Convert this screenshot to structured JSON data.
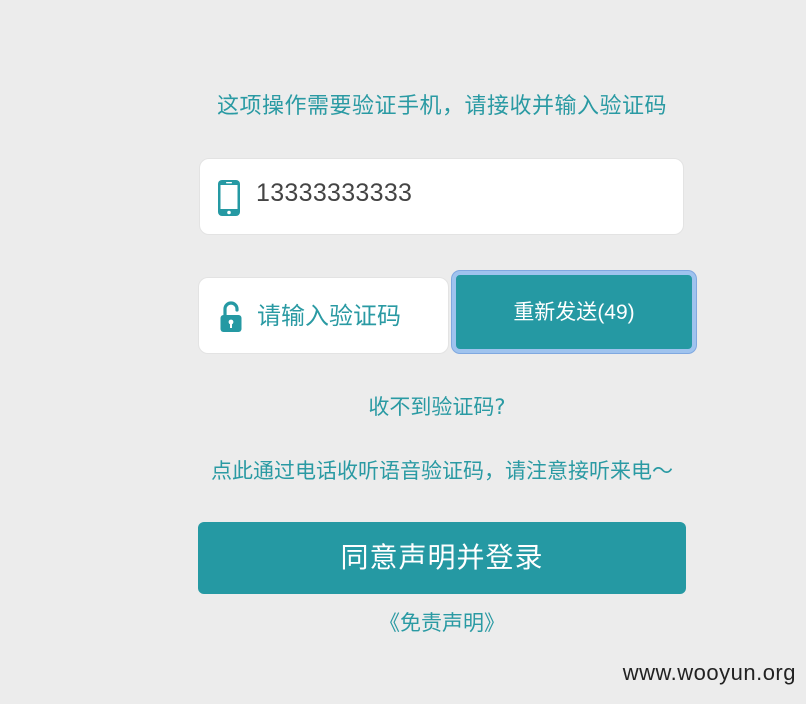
{
  "instruction": "这项操作需要验证手机，请接收并输入验证码",
  "phone": {
    "icon": "mobile-phone-icon",
    "value": "13333333333"
  },
  "code": {
    "icon": "unlocked-padlock-icon",
    "placeholder": "请输入验证码",
    "value": ""
  },
  "resend": {
    "label": "重新发送",
    "count": "(49)"
  },
  "no_code_link": "收不到验证码?",
  "voice_link": "点此通过电话收听语音验证码，请注意接听来电～",
  "login_button": "同意声明并登录",
  "disclaimer_link": "《免责声明》",
  "watermark": "www.wooyun.org",
  "colors": {
    "accent": "#2599a3",
    "text_accent": "#2a9aa3",
    "background": "#ececec",
    "focus_ring": "#9fc3ee"
  }
}
